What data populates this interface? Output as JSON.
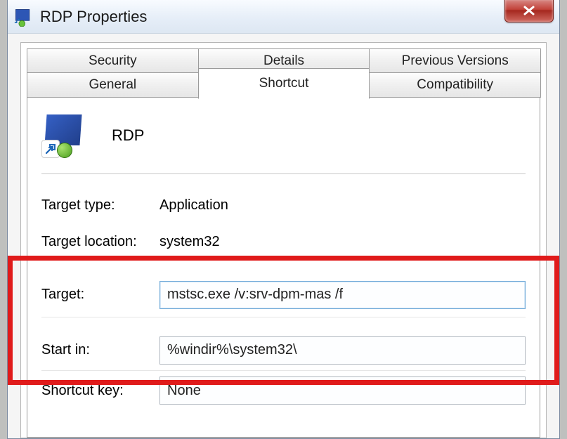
{
  "window": {
    "title": "RDP Properties",
    "close_label": "x"
  },
  "tabs": {
    "security": "Security",
    "details": "Details",
    "previous_versions": "Previous Versions",
    "general": "General",
    "shortcut": "Shortcut",
    "compatibility": "Compatibility"
  },
  "shortcut": {
    "name": "RDP",
    "labels": {
      "target_type": "Target type:",
      "target_location": "Target location:",
      "target": "Target:",
      "start_in": "Start in:",
      "shortcut_key": "Shortcut key:"
    },
    "values": {
      "target_type": "Application",
      "target_location": "system32",
      "target": "mstsc.exe /v:srv-dpm-mas /f",
      "start_in": "%windir%\\system32\\",
      "shortcut_key": "None"
    }
  }
}
